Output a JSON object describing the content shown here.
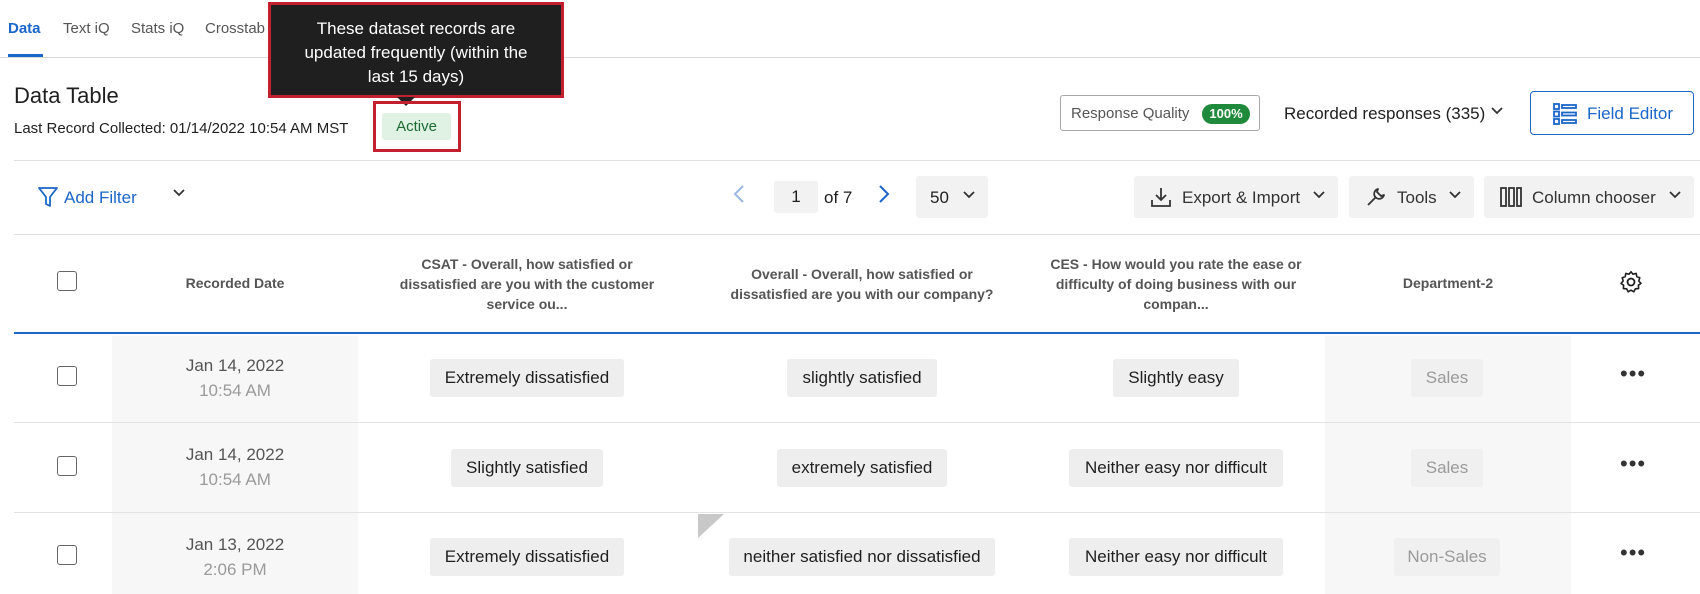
{
  "tabs": [
    "Data",
    "Text iQ",
    "Stats iQ",
    "Crosstab"
  ],
  "tooltip": "These dataset records are updated frequently (within the last 15 days)",
  "header": {
    "title": "Data Table",
    "last_record": "Last Record Collected: 01/14/2022 10:54 AM MST",
    "status": "Active",
    "response_quality_label": "Response Quality",
    "response_quality_value": "100%",
    "recorded_responses": "Recorded responses (335)",
    "field_editor": "Field Editor"
  },
  "toolbar": {
    "add_filter": "Add Filter",
    "page": "1",
    "page_of": "of 7",
    "per_page": "50",
    "export_import": "Export & Import",
    "tools": "Tools",
    "column_chooser": "Column chooser"
  },
  "columns": [
    "Recorded Date",
    "CSAT - Overall, how satisfied or dissatisfied are you with the customer service ou...",
    "Overall - Overall, how satisfied or dissatisfied are you with our company?",
    "CES - How would you rate the ease or difficulty of doing business with our compan...",
    "Department-2"
  ],
  "rows": [
    {
      "date": "Jan 14, 2022",
      "time": "10:54 AM",
      "csat": "Extremely dissatisfied",
      "overall": "slightly satisfied",
      "ces": "Slightly easy",
      "department": "Sales"
    },
    {
      "date": "Jan 14, 2022",
      "time": "10:54 AM",
      "csat": "Slightly satisfied",
      "overall": "extremely satisfied",
      "ces": "Neither easy nor difficult",
      "department": "Sales"
    },
    {
      "date": "Jan 13, 2022",
      "time": "2:06 PM",
      "csat": "Extremely dissatisfied",
      "overall": "neither satisfied nor dissatisfied",
      "ces": "Neither easy nor difficult",
      "department": "Non-Sales"
    }
  ],
  "colors": {
    "accent": "#1a66c9",
    "highlight_frame": "#c2202f",
    "active_bg": "#dff2e3",
    "quality_pill": "#1f8a3b"
  },
  "icons": [
    "filter-icon",
    "chevron-down-icon",
    "chevron-left-icon",
    "chevron-right-icon",
    "download-icon",
    "wrench-icon",
    "columns-icon",
    "field-editor-icon",
    "gear-icon",
    "more-icon"
  ]
}
